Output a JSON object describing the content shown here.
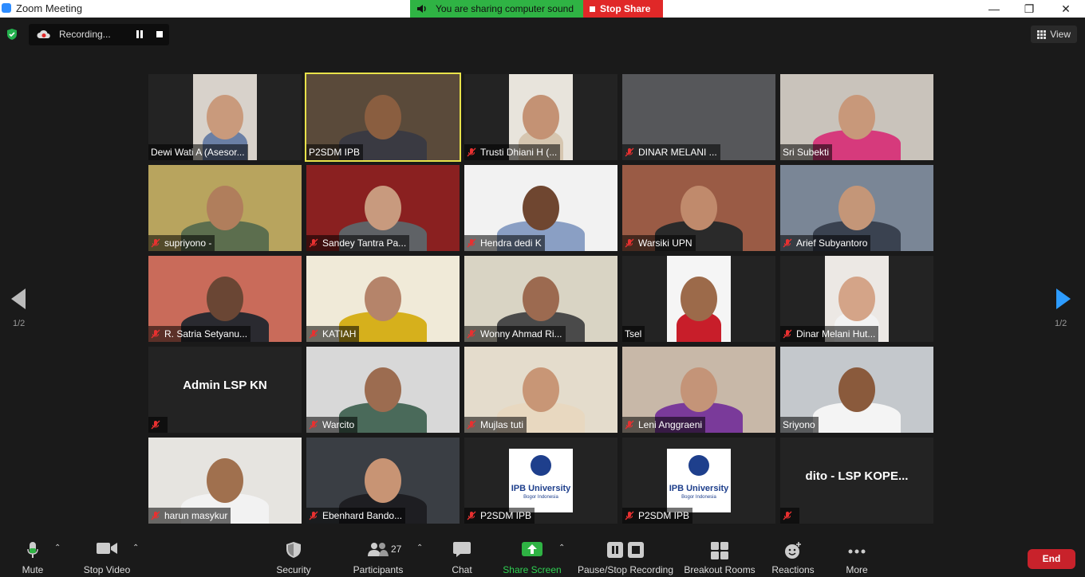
{
  "window": {
    "title": "Zoom Meeting",
    "minimize": "—",
    "restore": "❐",
    "close": "✕"
  },
  "share_bar": {
    "status": "You are sharing computer sound",
    "stop_label": "Stop Share"
  },
  "recording": {
    "label": "Recording..."
  },
  "view_button": {
    "label": "View"
  },
  "pagination": {
    "left": "1/2",
    "right": "1/2"
  },
  "participants": [
    {
      "name": "Dewi Wati A (Asesor...",
      "muted": false,
      "video": true,
      "bg": "#d8d2cb",
      "shirt": "#6a7fa5",
      "skin": "#c99a7c"
    },
    {
      "name": "P2SDM IPB",
      "muted": false,
      "video": true,
      "active": true,
      "bg": "#5a4a3a",
      "shirt": "#3a3a42",
      "skin": "#8a5e40"
    },
    {
      "name": "Trusti Dhiani H (...",
      "muted": true,
      "video": true,
      "bg": "#e8e4dc",
      "shirt": "#d6c6b0",
      "skin": "#c49274"
    },
    {
      "name": "DINAR MELANI ...",
      "muted": true,
      "video": true,
      "bg": "#56575a",
      "shirt": "#56575a",
      "skin": "#56575a"
    },
    {
      "name": "Sri Subekti",
      "muted": false,
      "video": true,
      "bg": "#c9c3bb",
      "shirt": "#d63a7c",
      "skin": "#c8987a"
    },
    {
      "name": "supriyono -",
      "muted": true,
      "video": true,
      "bg": "#b8a45e",
      "shirt": "#5c6e4e",
      "skin": "#b07e5c"
    },
    {
      "name": "Sandey Tantra Pa...",
      "muted": true,
      "video": true,
      "bg": "#8a2020",
      "shirt": "#5f6266",
      "skin": "#c89a7e"
    },
    {
      "name": "Hendra dedi K",
      "muted": true,
      "video": true,
      "bg": "#f2f2f2",
      "shirt": "#8a9fc4",
      "skin": "#6f4630"
    },
    {
      "name": "Warsiki UPN",
      "muted": true,
      "video": true,
      "bg": "#9a5b45",
      "shirt": "#2a2a2a",
      "skin": "#c08a6c"
    },
    {
      "name": "Arief Subyantoro",
      "muted": true,
      "video": true,
      "bg": "#7a8696",
      "shirt": "#3a4250",
      "skin": "#c49678"
    },
    {
      "name": "R. Satria Setyanu...",
      "muted": true,
      "video": true,
      "bg": "#c96b5a",
      "shirt": "#2a2a30",
      "skin": "#6a4634"
    },
    {
      "name": "KATIAH",
      "muted": true,
      "video": true,
      "bg": "#f0ead8",
      "shirt": "#d6b01c",
      "skin": "#b5846a"
    },
    {
      "name": "Wonny Ahmad Ri...",
      "muted": true,
      "video": true,
      "bg": "#d9d4c4",
      "shirt": "#4a4a4a",
      "skin": "#9c6a50"
    },
    {
      "name": "Tsel",
      "muted": false,
      "video": true,
      "bg": "#f5f5f5",
      "shirt": "#c81e2a",
      "skin": "#9c6a4a"
    },
    {
      "name": "Dinar Melani Hut...",
      "muted": true,
      "video": true,
      "bg": "#ece8e4",
      "shirt": "#f2f2f2",
      "skin": "#d4a488"
    },
    {
      "name": "Admin LSP KN",
      "muted": true,
      "video": false,
      "bg": "#232323"
    },
    {
      "name": "Warcito",
      "muted": true,
      "video": true,
      "bg": "#d8d8d8",
      "shirt": "#4a6a5a",
      "skin": "#9c6c50"
    },
    {
      "name": "Mujlas tuti",
      "muted": true,
      "video": true,
      "bg": "#e4dccc",
      "shirt": "#e8d8c0",
      "skin": "#c89676"
    },
    {
      "name": "Leni Anggraeni",
      "muted": true,
      "video": true,
      "bg": "#c8b8a8",
      "shirt": "#7a3a9a",
      "skin": "#c49478"
    },
    {
      "name": "Sriyono",
      "muted": false,
      "video": true,
      "bg": "#c4c8cc",
      "shirt": "#f4f4f4",
      "skin": "#8a5a3c"
    },
    {
      "name": "harun masykur",
      "muted": true,
      "video": true,
      "bg": "#e6e4e0",
      "shirt": "#f2f2f2",
      "skin": "#a0704e"
    },
    {
      "name": "Ebenhard Bando...",
      "muted": true,
      "video": true,
      "bg": "#3a3e44",
      "shirt": "#1e1e22",
      "skin": "#c89474"
    },
    {
      "name": "P2SDM IPB",
      "muted": true,
      "video": false,
      "logo": true,
      "bg": "#232323"
    },
    {
      "name": "P2SDM IPB",
      "muted": true,
      "video": false,
      "logo": true,
      "bg": "#232323"
    },
    {
      "name": "dito - LSP KOPE...",
      "muted": true,
      "video": false,
      "bg": "#232323"
    }
  ],
  "ipb_logo": {
    "line1": "IPB University",
    "line2": "Bogor Indonesia"
  },
  "toolbar": {
    "mute": "Mute",
    "stop_video": "Stop Video",
    "security": "Security",
    "participants": "Participants",
    "participants_count": "27",
    "chat": "Chat",
    "share_screen": "Share Screen",
    "recording": "Pause/Stop Recording",
    "breakout_rooms": "Breakout Rooms",
    "reactions": "Reactions",
    "more": "More",
    "end": "End"
  },
  "colors": {
    "accent_green": "#2fb344",
    "stop_red": "#e02828",
    "end_red": "#c8222b",
    "active_speaker": "#e8e24a",
    "nav_arrow": "#2d9cff"
  }
}
